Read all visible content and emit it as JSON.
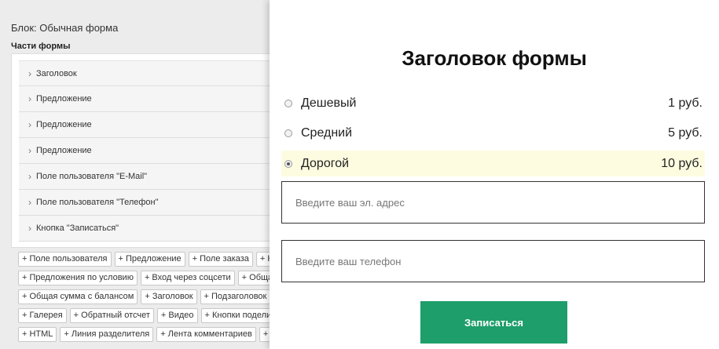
{
  "editor": {
    "block_title": "Блок: Обычная форма",
    "parts_title": "Части формы",
    "parts": [
      "Заголовок",
      "Предложение",
      "Предложение",
      "Предложение",
      "Поле пользователя \"E-Mail\"",
      "Поле пользователя \"Телефон\"",
      "Кнопка \"Записаться\""
    ],
    "add_rows": [
      [
        "+ Поле пользователя",
        "+ Предложение",
        "+ Поле заказа",
        "+ К"
      ],
      [
        "+ Предложения по условию",
        "+ Вход через соцсети",
        "+ Общая"
      ],
      [
        "+ Общая сумма с балансом",
        "+ Заголовок",
        "+ Подзаголовок"
      ],
      [
        "+ Галерея",
        "+ Обратный отсчет",
        "+ Видео",
        "+ Кнопки поделиться"
      ],
      [
        "+ HTML",
        "+ Линия разделителя",
        "+ Лента комментариев",
        "+ К"
      ]
    ]
  },
  "preview": {
    "heading": "Заголовок формы",
    "options": [
      {
        "label": "Дешевый",
        "price": "1 руб.",
        "selected": false
      },
      {
        "label": "Средний",
        "price": "5 руб.",
        "selected": false
      },
      {
        "label": "Дорогой",
        "price": "10 руб.",
        "selected": true
      }
    ],
    "email_placeholder": "Введите ваш эл. адрес",
    "phone_placeholder": "Введите ваш телефон",
    "submit_label": "Записаться"
  },
  "colors": {
    "accent_button": "#1e9e6a",
    "selected_option_bg": "#fdfce0"
  }
}
